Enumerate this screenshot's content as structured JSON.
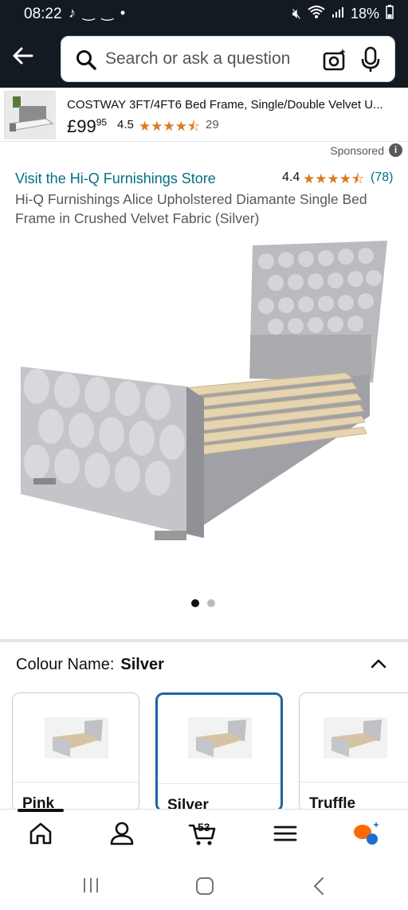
{
  "status": {
    "time": "08:22",
    "battery": "18%"
  },
  "search": {
    "placeholder": "Search or ask a question"
  },
  "ad": {
    "title": "COSTWAY 3FT/4FT6 Bed Frame, Single/Double Velvet U...",
    "price_main": "£99",
    "price_cents": "95",
    "rating": "4.5",
    "stars": "★★★★⯪",
    "count": "29"
  },
  "sponsored_label": "Sponsored",
  "product": {
    "store_link": "Visit the Hi-Q Furnishings Store",
    "rating": "4.4",
    "stars": "★★★★⯪",
    "review_count": "(78)",
    "title": "Hi-Q Furnishings Alice Upholstered Diamante Single Bed Frame in Crushed Velvet Fabric (Silver)"
  },
  "carousel": {
    "current": 1,
    "total": 2
  },
  "colour": {
    "label": "Colour Name:",
    "selected": "Silver",
    "options": [
      "Pink",
      "Silver",
      "Truffle"
    ]
  },
  "bottom_nav": {
    "cart_count": "53"
  },
  "colors": {
    "header_bg": "#131a22",
    "link": "#007185",
    "star": "#de7921",
    "selected_border": "#2162a1"
  }
}
